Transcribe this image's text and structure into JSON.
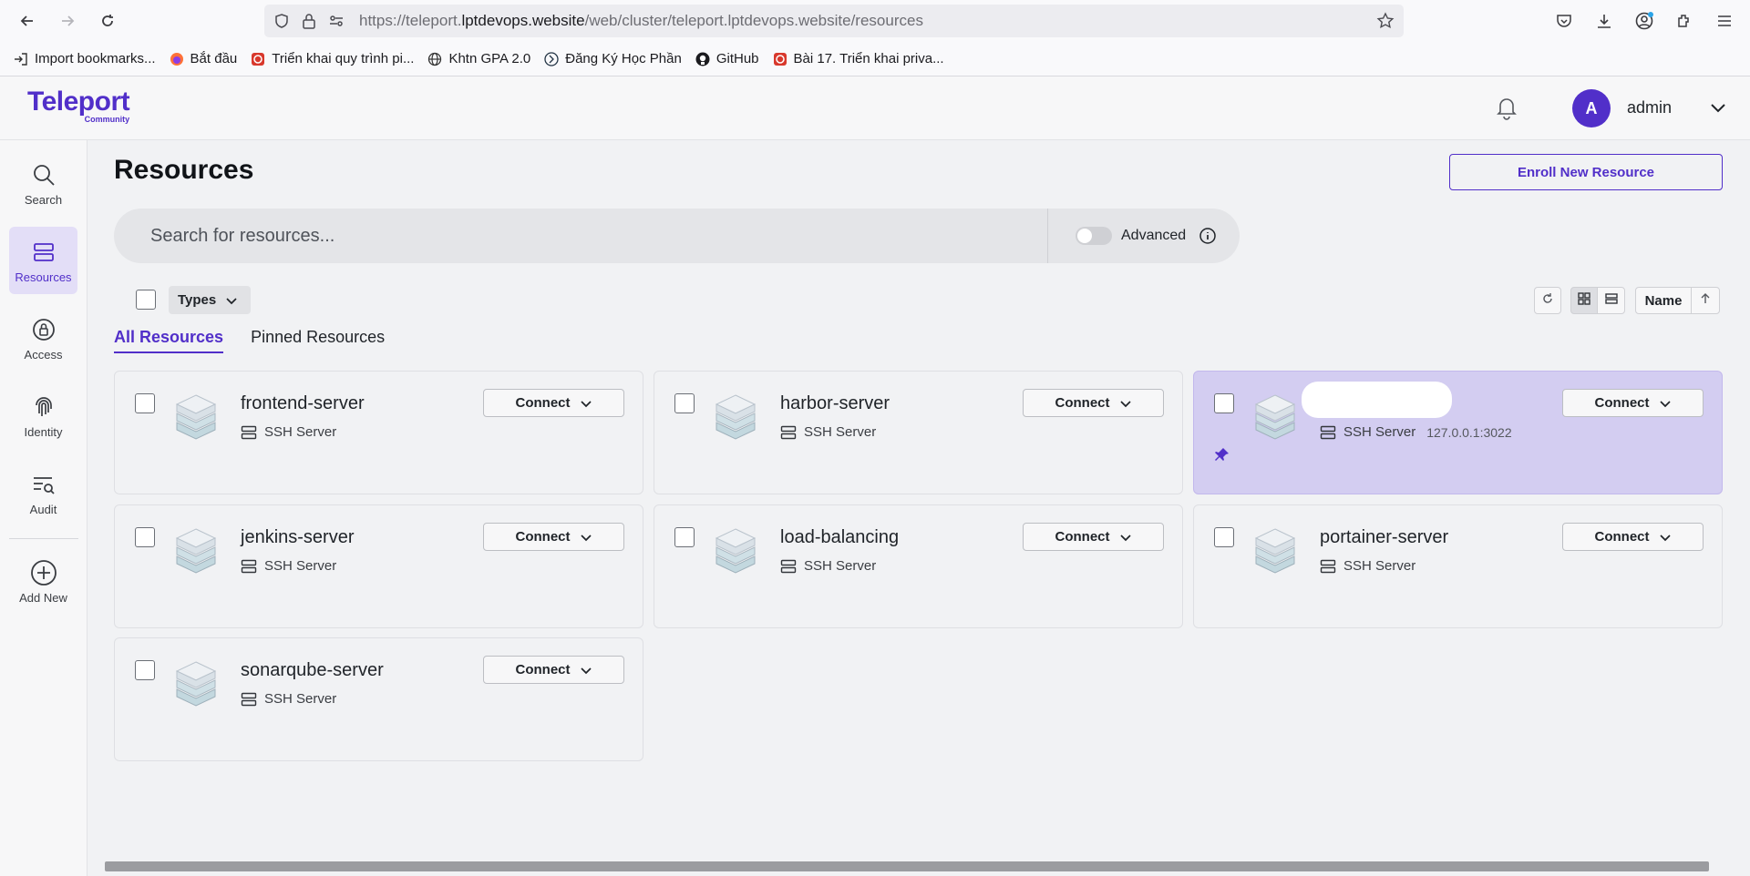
{
  "browser": {
    "url_prefix": "https://teleport.",
    "url_domain": "lptdevops.website",
    "url_suffix": "/web/cluster/teleport.lptdevops.website/resources",
    "bookmarks": [
      {
        "label": "Import bookmarks...",
        "icon": "import-icon"
      },
      {
        "label": "Bắt đầu",
        "icon": "firefox-icon"
      },
      {
        "label": "Triển khai quy trình pi...",
        "icon": "red-site-icon"
      },
      {
        "label": "Khtn GPA 2.0",
        "icon": "globe-icon"
      },
      {
        "label": "Đăng Ký Học Phần",
        "icon": "school-icon"
      },
      {
        "label": "GitHub",
        "icon": "github-icon"
      },
      {
        "label": "Bài 17. Triển khai priva...",
        "icon": "red-site-icon"
      }
    ]
  },
  "app": {
    "logo": "Teleport",
    "logo_sub": "Community",
    "user_initial": "A",
    "username": "admin",
    "brand_color": "#512fc9"
  },
  "sidebar": {
    "items": [
      {
        "label": "Search",
        "icon": "search-icon"
      },
      {
        "label": "Resources",
        "icon": "server-icon",
        "active": true
      },
      {
        "label": "Access",
        "icon": "lock-icon"
      },
      {
        "label": "Identity",
        "icon": "fingerprint-icon"
      },
      {
        "label": "Audit",
        "icon": "audit-icon"
      },
      {
        "label": "Add New",
        "icon": "plus-circle-icon"
      }
    ]
  },
  "main": {
    "title": "Resources",
    "enroll_label": "Enroll New Resource",
    "search_placeholder": "Search for resources...",
    "advanced_label": "Advanced",
    "types_label": "Types",
    "sort_label": "Name",
    "tabs": [
      {
        "label": "All Resources",
        "active": true
      },
      {
        "label": "Pinned Resources",
        "active": false
      }
    ]
  },
  "resources": [
    {
      "name": "frontend-server",
      "type": "SSH Server",
      "connect": "Connect"
    },
    {
      "name": "harbor-server",
      "type": "SSH Server",
      "connect": "Connect"
    },
    {
      "name": "",
      "type": "SSH Server",
      "addr": "127.0.0.1:3022",
      "connect": "Connect",
      "pinned": true
    },
    {
      "name": "jenkins-server",
      "type": "SSH Server",
      "connect": "Connect"
    },
    {
      "name": "load-balancing",
      "type": "SSH Server",
      "connect": "Connect"
    },
    {
      "name": "portainer-server",
      "type": "SSH Server",
      "connect": "Connect"
    },
    {
      "name": "sonarqube-server",
      "type": "SSH Server",
      "connect": "Connect"
    }
  ]
}
